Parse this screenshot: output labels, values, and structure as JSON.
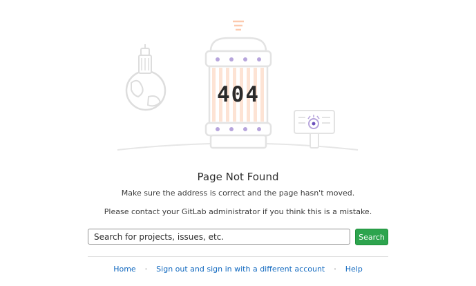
{
  "illustration": {
    "code_text": "404"
  },
  "page": {
    "title": "Page Not Found",
    "subtitle_1": "Make sure the address is correct and the page hasn't moved.",
    "subtitle_2": "Please contact your GitLab administrator if you think this is a mistake."
  },
  "search": {
    "placeholder": "Search for projects, issues, etc.",
    "button_label": "Search"
  },
  "footer_links": {
    "home": "Home",
    "separator": "·",
    "sign_out": "Sign out and sign in with a different account",
    "help": "Help"
  },
  "colors": {
    "accent_green": "#2da44e",
    "link_blue": "#1068bf",
    "illustration_orange": "#fcd7c2",
    "illustration_purple": "#b7a5dc"
  }
}
